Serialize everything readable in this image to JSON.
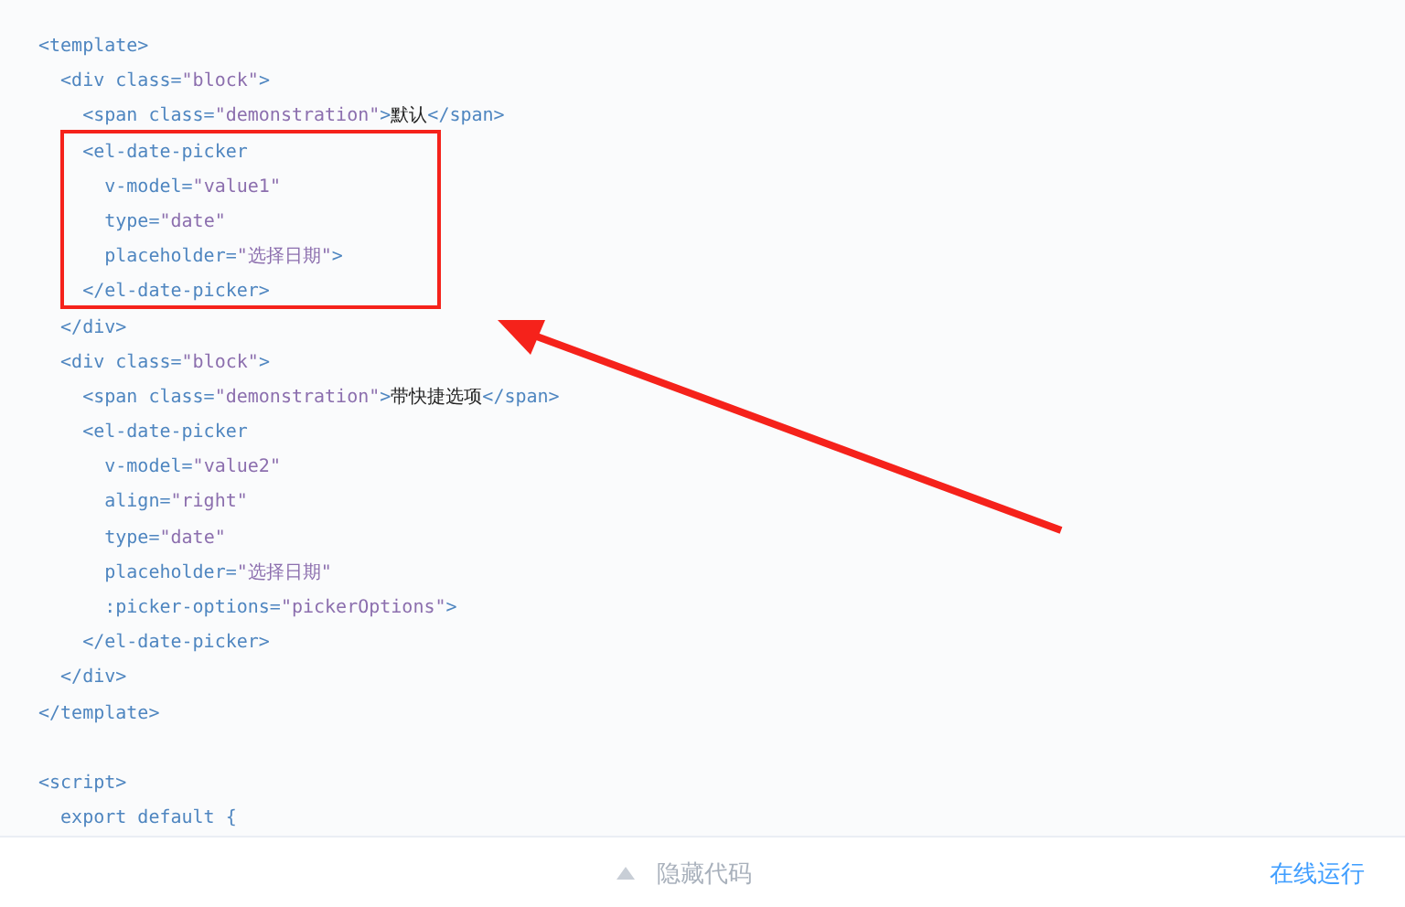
{
  "code_lines": [
    {
      "highlighted": false,
      "parts": [
        {
          "kind": "tag",
          "text": "<template>"
        }
      ]
    },
    {
      "highlighted": false,
      "parts": [
        {
          "kind": "tag",
          "text": "  <div class="
        },
        {
          "kind": "string",
          "text": "\"block\""
        },
        {
          "kind": "tag",
          "text": ">"
        }
      ]
    },
    {
      "highlighted": false,
      "parts": [
        {
          "kind": "tag",
          "text": "    <span class="
        },
        {
          "kind": "string",
          "text": "\"demonstration\""
        },
        {
          "kind": "tag",
          "text": ">"
        },
        {
          "kind": "text",
          "text": "默认"
        },
        {
          "kind": "tag",
          "text": "</span>"
        }
      ]
    },
    {
      "highlighted": true,
      "parts": [
        {
          "kind": "tag",
          "text": "    <el-date-picker"
        }
      ]
    },
    {
      "highlighted": true,
      "parts": [
        {
          "kind": "tag",
          "text": "      v-model="
        },
        {
          "kind": "string",
          "text": "\"value1\""
        }
      ]
    },
    {
      "highlighted": true,
      "parts": [
        {
          "kind": "tag",
          "text": "      type="
        },
        {
          "kind": "string",
          "text": "\"date\""
        }
      ]
    },
    {
      "highlighted": true,
      "parts": [
        {
          "kind": "tag",
          "text": "      placeholder="
        },
        {
          "kind": "string",
          "text": "\"选择日期\""
        },
        {
          "kind": "tag",
          "text": ">"
        }
      ]
    },
    {
      "highlighted": true,
      "parts": [
        {
          "kind": "tag",
          "text": "    </el-date-picker>"
        }
      ]
    },
    {
      "highlighted": false,
      "parts": [
        {
          "kind": "tag",
          "text": "  </div>"
        }
      ]
    },
    {
      "highlighted": false,
      "parts": [
        {
          "kind": "tag",
          "text": "  <div class="
        },
        {
          "kind": "string",
          "text": "\"block\""
        },
        {
          "kind": "tag",
          "text": ">"
        }
      ]
    },
    {
      "highlighted": false,
      "parts": [
        {
          "kind": "tag",
          "text": "    <span class="
        },
        {
          "kind": "string",
          "text": "\"demonstration\""
        },
        {
          "kind": "tag",
          "text": ">"
        },
        {
          "kind": "text",
          "text": "带快捷选项"
        },
        {
          "kind": "tag",
          "text": "</span>"
        }
      ]
    },
    {
      "highlighted": false,
      "parts": [
        {
          "kind": "tag",
          "text": "    <el-date-picker"
        }
      ]
    },
    {
      "highlighted": false,
      "parts": [
        {
          "kind": "tag",
          "text": "      v-model="
        },
        {
          "kind": "string",
          "text": "\"value2\""
        }
      ]
    },
    {
      "highlighted": false,
      "parts": [
        {
          "kind": "tag",
          "text": "      align="
        },
        {
          "kind": "string",
          "text": "\"right\""
        }
      ]
    },
    {
      "highlighted": false,
      "parts": [
        {
          "kind": "tag",
          "text": "      type="
        },
        {
          "kind": "string",
          "text": "\"date\""
        }
      ]
    },
    {
      "highlighted": false,
      "parts": [
        {
          "kind": "tag",
          "text": "      placeholder="
        },
        {
          "kind": "string",
          "text": "\"选择日期\""
        }
      ]
    },
    {
      "highlighted": false,
      "parts": [
        {
          "kind": "tag",
          "text": "      :picker-options="
        },
        {
          "kind": "string",
          "text": "\"pickerOptions\""
        },
        {
          "kind": "tag",
          "text": ">"
        }
      ]
    },
    {
      "highlighted": false,
      "parts": [
        {
          "kind": "tag",
          "text": "    </el-date-picker>"
        }
      ]
    },
    {
      "highlighted": false,
      "parts": [
        {
          "kind": "tag",
          "text": "  </div>"
        }
      ]
    },
    {
      "highlighted": false,
      "parts": [
        {
          "kind": "tag",
          "text": "</template>"
        }
      ]
    },
    {
      "highlighted": false
    },
    {
      "highlighted": false,
      "parts": [
        {
          "kind": "tag",
          "text": "<script>"
        }
      ]
    },
    {
      "highlighted": false,
      "parts": [
        {
          "kind": "tag",
          "text": "  export default {"
        }
      ]
    }
  ],
  "footer": {
    "toggle_label": "隐藏代码",
    "run_link": "在线运行"
  }
}
